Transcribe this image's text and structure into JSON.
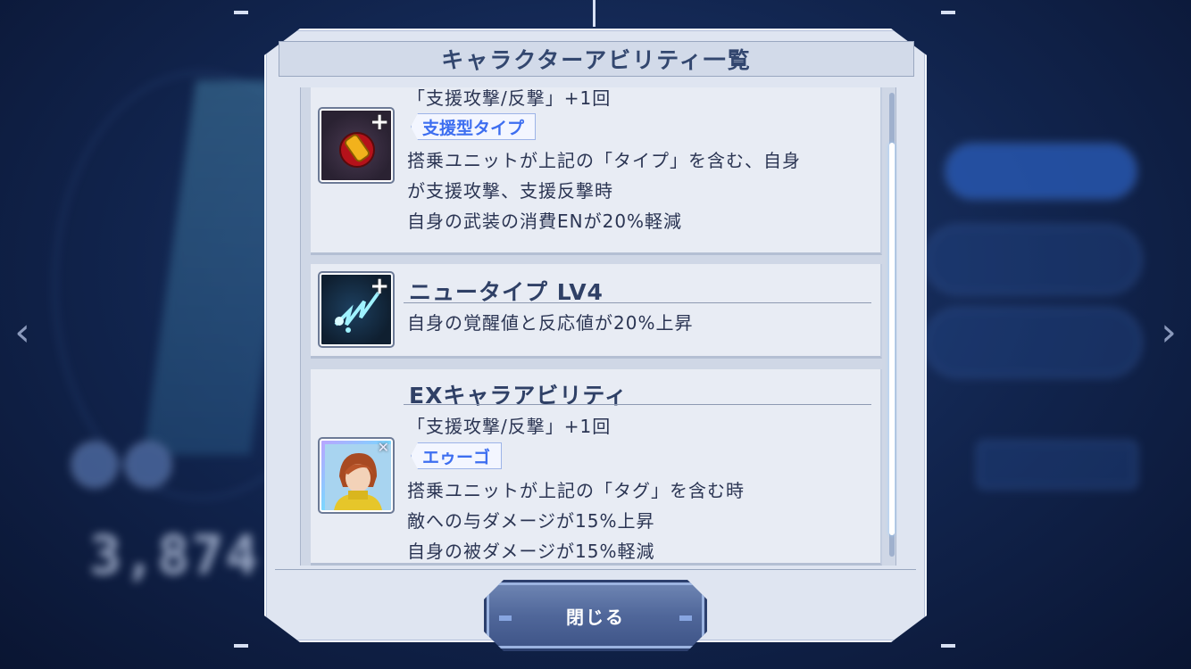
{
  "dialog": {
    "title": "キャラクターアビリティ一覧"
  },
  "abilities": [
    {
      "title": "",
      "partial_top_line": "「支援攻撃/反撃」+1回",
      "icon": "bullet-shell-icon",
      "tag": "支援型タイプ",
      "lines": [
        "搭乗ユニットが上記の「タイプ」を含む、自身",
        "が支援攻撃、支援反撃時",
        "自身の武装の消費ENが20%軽減"
      ]
    },
    {
      "title": "ニュータイプ LV4",
      "icon": "newtype-lightning-icon",
      "lines": [
        "自身の覚醒値と反応値が20%上昇"
      ]
    },
    {
      "title": "EXキャラアビリティ",
      "icon": "character-portrait-icon",
      "tag": "エゥーゴ",
      "lines": [
        "「支援攻撃/反撃」+1回",
        "搭乗ユニットが上記の「タグ」を含む時",
        "敵への与ダメージが15%上昇",
        "自身の被ダメージが15%軽減"
      ]
    }
  ],
  "buttons": {
    "close_label": "閉じる"
  },
  "background": {
    "big_number": "3,874"
  },
  "colors": {
    "accent_blue": "#3d6ef0",
    "title_text": "#33476f",
    "panel": "#dfe5f1"
  }
}
